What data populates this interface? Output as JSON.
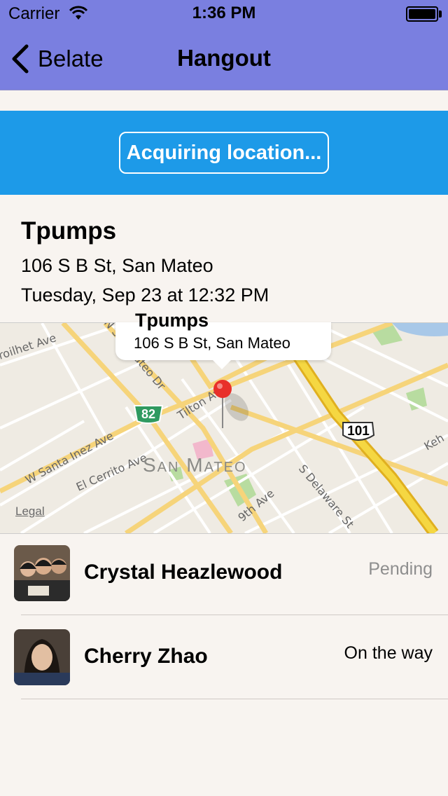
{
  "status_bar": {
    "carrier": "Carrier",
    "time": "1:36 PM"
  },
  "nav": {
    "back_label": "Belate",
    "title": "Hangout"
  },
  "banner": {
    "button_label": "Acquiring location...",
    "color": "#1d9ae8"
  },
  "venue": {
    "name": "Tpumps",
    "address": "106 S B St, San Mateo",
    "time": "Tuesday, Sep 23 at 12:32 PM"
  },
  "map": {
    "callout_title": "Tpumps",
    "callout_address": "106 S B St, San Mateo",
    "city_label": "San Mateo",
    "legal": "Legal",
    "labels": {
      "ave_top_left": "roilhet Ave",
      "santa_inez": "W Santa Inez Ave",
      "el_cerrito": "El Cerrito Ave",
      "tilton": "Tilton Ave",
      "ninth_ave": "9th Ave",
      "delaware": "S Delaware St",
      "road_top_middle": "N San Mateo Dr",
      "road_right_edge": "Keh",
      "shield_82": "82",
      "shield_101": "101"
    }
  },
  "people": [
    {
      "name": "Crystal Heazlewood",
      "status": "Pending",
      "status_color": "#8e8e8e"
    },
    {
      "name": "Cherry Zhao",
      "status": "On the way",
      "status_color": "#000000"
    }
  ]
}
